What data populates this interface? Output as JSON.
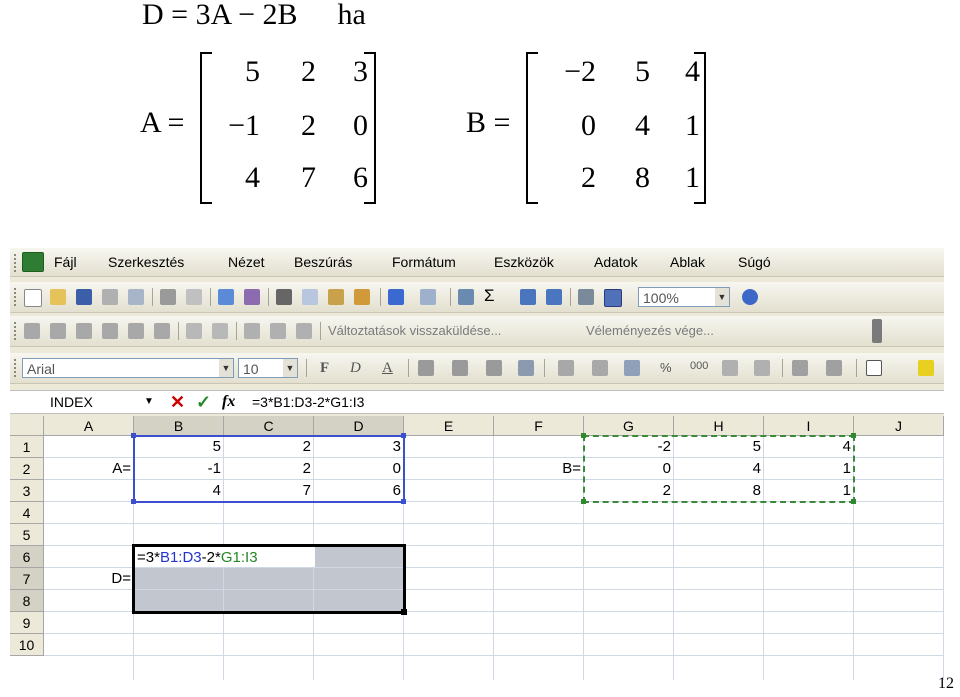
{
  "equation": {
    "lhs": "D = 3A − 2B",
    "ha": "ha"
  },
  "matrixA": {
    "label": "A =",
    "rows": [
      [
        "5",
        "2",
        "3"
      ],
      [
        "−1",
        "2",
        "0"
      ],
      [
        "4",
        "7",
        "6"
      ]
    ]
  },
  "matrixB": {
    "label": "B =",
    "rows": [
      [
        "−2",
        "5",
        "4"
      ],
      [
        "0",
        "4",
        "1"
      ],
      [
        "2",
        "8",
        "1"
      ]
    ]
  },
  "menu": [
    "Fájl",
    "Szerkesztés",
    "Nézet",
    "Beszúrás",
    "Formátum",
    "Eszközök",
    "Adatok",
    "Ablak",
    "Súgó"
  ],
  "toolbar": {
    "zoom": "100%",
    "review_send": "Változtatások visszaküldése...",
    "review_end": "Véleményezés vége...",
    "font": "Arial",
    "size": "10",
    "bold": "F",
    "italic": "D",
    "underline": "A",
    "sigma": "Σ",
    "percent": "%",
    "thousands": "000"
  },
  "formula_bar": {
    "name_box": "INDEX",
    "cancel": "✕",
    "enter": "✓",
    "fx": "fx",
    "formula": "=3*B1:D3-2*G1:I3"
  },
  "columns": [
    "A",
    "B",
    "C",
    "D",
    "E",
    "F",
    "G",
    "H",
    "I",
    "J"
  ],
  "rows": [
    "1",
    "2",
    "3",
    "4",
    "5",
    "6",
    "7",
    "8",
    "9",
    "10"
  ],
  "cells": {
    "B1": "5",
    "C1": "2",
    "D1": "3",
    "A2": "A=",
    "B2": "-1",
    "C2": "2",
    "D2": "0",
    "B3": "4",
    "C3": "7",
    "D3": "6",
    "G1": "-2",
    "H1": "5",
    "I1": "4",
    "F2": "B=",
    "G2": "0",
    "H2": "4",
    "I2": "1",
    "G3": "2",
    "H3": "8",
    "I3": "1",
    "A7": "D="
  },
  "edit_cell": {
    "p1": "=3*",
    "ref1": "B1:D3",
    "p2": "-2*",
    "ref2": "G1:I3"
  },
  "page_number": "12",
  "colors": {
    "selection_blue": "#3b4fcf",
    "copy_marquee_green": "#3a8a3a",
    "range_shade": "#c2c6ce"
  }
}
